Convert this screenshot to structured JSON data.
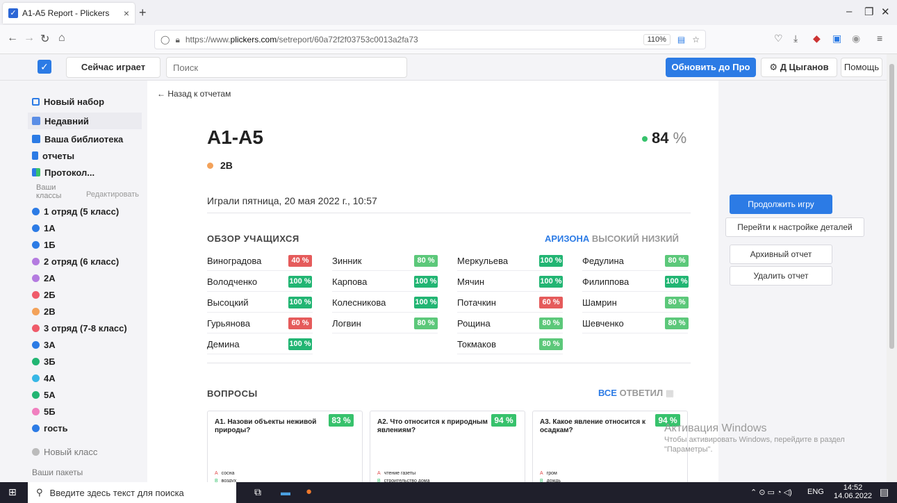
{
  "browser": {
    "tab_title": "A1-A5 Report - Plickers",
    "url_prefix": "https://www.",
    "url_host": "plickers.com",
    "url_path": "/setreport/60a72f2f03753c0013a2fa73",
    "zoom": "110%"
  },
  "header": {
    "now_playing": "Сейчас играет",
    "search_placeholder": "Поиск",
    "upgrade": "Обновить до Про",
    "user": "Д Цыганов",
    "help": "Помощь"
  },
  "sidebar": {
    "new_set": "Новый набор",
    "recent": "Недавний",
    "library": "Ваша библиотека",
    "reports": "отчеты",
    "protocol": "Протокол...",
    "your_classes": "Ваши классы",
    "edit": "Редактировать",
    "classes": [
      {
        "name": "1 отряд (5 класс)",
        "color": "#2c7be5"
      },
      {
        "name": "1А",
        "color": "#2c7be5"
      },
      {
        "name": "1Б",
        "color": "#2c7be5"
      },
      {
        "name": "2 отряд (6 класс)",
        "color": "#b47be0"
      },
      {
        "name": "2А",
        "color": "#b47be0"
      },
      {
        "name": "2Б",
        "color": "#ef5b6a"
      },
      {
        "name": "2В",
        "color": "#f3a25a"
      },
      {
        "name": "3 отряд (7-8 класс)",
        "color": "#ef5b6a"
      },
      {
        "name": "3А",
        "color": "#2c7be5"
      },
      {
        "name": "3Б",
        "color": "#22b573"
      },
      {
        "name": "4А",
        "color": "#37b7e6"
      },
      {
        "name": "5А",
        "color": "#22b573"
      },
      {
        "name": "5Б",
        "color": "#f07fbf"
      },
      {
        "name": "гость",
        "color": "#2c7be5"
      }
    ],
    "new_class": "Новый класс",
    "your_packs": "Ваши пакеты"
  },
  "report": {
    "back": "← Назад к отчетам",
    "title": "А1-А5",
    "score": "84",
    "score_unit": "%",
    "class_name": "2В",
    "played": "Играли пятница, 20 мая 2022 г., 10:57",
    "students_title": "ОБЗОР УЧАЩИХСЯ",
    "sort_az": "АРИЗОНА",
    "sort_high": "ВЫСОКИЙ",
    "sort_low": "НИЗКИЙ",
    "students": [
      [
        {
          "name": "Виноградова",
          "score": "40 %",
          "color": "#e55b5b"
        },
        {
          "name": "Володченко",
          "score": "100 %",
          "color": "#22b573"
        },
        {
          "name": "Высоцкий",
          "score": "100 %",
          "color": "#22b573"
        },
        {
          "name": "Гурьянова",
          "score": "60 %",
          "color": "#e55b5b"
        },
        {
          "name": "Демина",
          "score": "100 %",
          "color": "#22b573"
        }
      ],
      [
        {
          "name": "Зинник",
          "score": "80 %",
          "color": "#5cc87a"
        },
        {
          "name": "Карпова",
          "score": "100 %",
          "color": "#22b573"
        },
        {
          "name": "Колесникова",
          "score": "100 %",
          "color": "#22b573"
        },
        {
          "name": "Логвин",
          "score": "80 %",
          "color": "#5cc87a"
        }
      ],
      [
        {
          "name": "Меркульева",
          "score": "100 %",
          "color": "#22b573"
        },
        {
          "name": "Мячин",
          "score": "100 %",
          "color": "#22b573"
        },
        {
          "name": "Потачкин",
          "score": "60 %",
          "color": "#e55b5b"
        },
        {
          "name": "Рощина",
          "score": "80 %",
          "color": "#5cc87a"
        },
        {
          "name": "Токмаков",
          "score": "80 %",
          "color": "#5cc87a"
        }
      ],
      [
        {
          "name": "Федулина",
          "score": "80 %",
          "color": "#5cc87a"
        },
        {
          "name": "Филиппова",
          "score": "100 %",
          "color": "#22b573"
        },
        {
          "name": "Шамрин",
          "score": "80 %",
          "color": "#5cc87a"
        },
        {
          "name": "Шевченко",
          "score": "80 %",
          "color": "#5cc87a"
        }
      ]
    ],
    "questions_title": "ВОПРОСЫ",
    "q_all": "ВСЕ",
    "q_answered": "ОТВЕТИЛ",
    "questions": [
      {
        "text": "А1. Назови объекты неживой природы?",
        "pct": "83 %",
        "answers": [
          {
            "letter": "A",
            "text": "сосна"
          },
          {
            "letter": "B",
            "text": "воздух"
          }
        ]
      },
      {
        "text": "А2. Что относится к природным явлениям?",
        "pct": "94 %",
        "answers": [
          {
            "letter": "A",
            "text": "чтение газеты"
          },
          {
            "letter": "B",
            "text": "строительство дома"
          }
        ]
      },
      {
        "text": "А3. Какое явление относится к осадкам?",
        "pct": "94 %",
        "answers": [
          {
            "letter": "A",
            "text": "гром"
          },
          {
            "letter": "B",
            "text": "дождь"
          }
        ]
      }
    ]
  },
  "right": {
    "continue": "Продолжить игру",
    "details": "Перейти к настройке деталей",
    "archive": "Архивный отчет",
    "delete": "Удалить отчет"
  },
  "watermark": {
    "line1": "Активация Windows",
    "line2": "Чтобы активировать Windows, перейдите в раздел \"Параметры\"."
  },
  "taskbar": {
    "search": "Введите здесь текст для поиска",
    "lang": "ENG",
    "time": "14:52",
    "date": "14.06.2022"
  }
}
